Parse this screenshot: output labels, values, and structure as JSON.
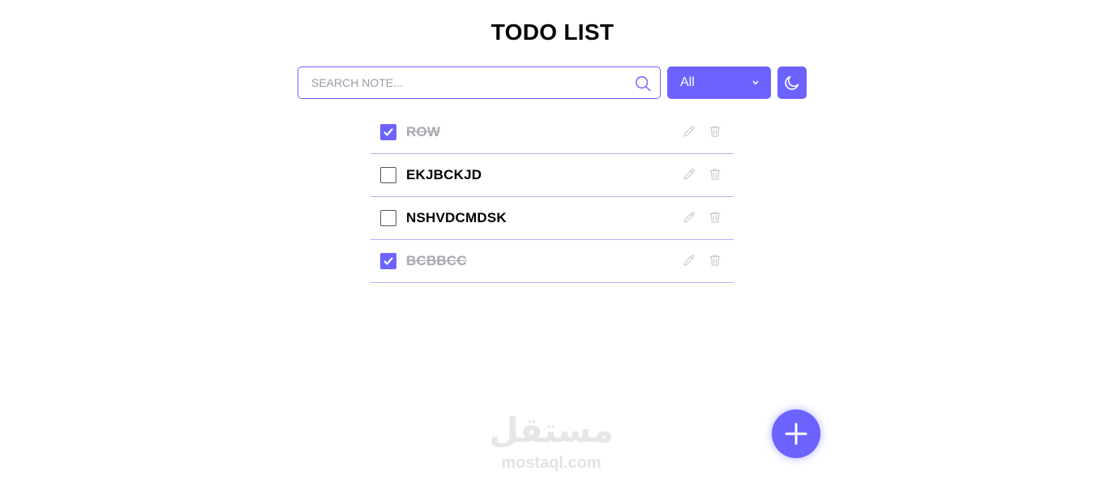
{
  "header": {
    "title": "TODO LIST"
  },
  "search": {
    "placeholder": "SEARCH NOTE...",
    "value": ""
  },
  "filter": {
    "selected": "All"
  },
  "todos": [
    {
      "text": "ROW",
      "completed": true
    },
    {
      "text": "EKJBCKJD",
      "completed": false
    },
    {
      "text": "NSHVDCMDSK",
      "completed": false
    },
    {
      "text": "BCBBCC",
      "completed": true
    }
  ],
  "watermark": {
    "logo_text": "مستقل",
    "domain": "mostaql.com"
  },
  "colors": {
    "accent": "#6c63ff",
    "divider": "#b9b3f5",
    "muted_text": "#a8a8b0",
    "icon_muted": "#c8c8ce"
  },
  "icons": {
    "search": "search-icon",
    "filter_dropdown": "chevron-down-icon",
    "theme_toggle": "moon-icon",
    "edit": "pencil-icon",
    "delete": "trash-icon",
    "add": "plus-icon",
    "checkbox": "checkmark-icon"
  }
}
